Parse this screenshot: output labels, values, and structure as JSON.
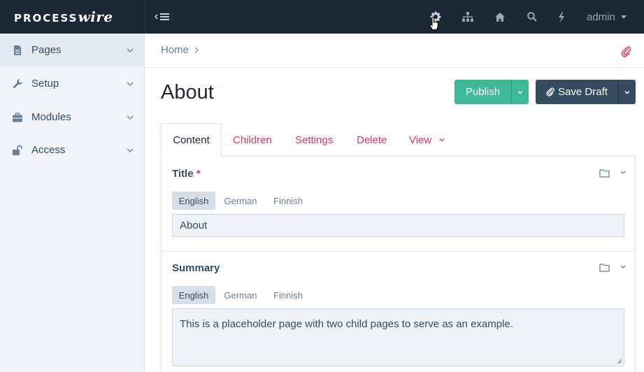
{
  "app": {
    "logo_main": "PROCESS",
    "logo_accent": "wire"
  },
  "topbar": {
    "icons": [
      "gear-icon",
      "sitemap-icon",
      "home-icon",
      "search-icon",
      "bolt-icon"
    ],
    "user_label": "admin"
  },
  "sidebar": {
    "items": [
      {
        "label": "Pages",
        "icon": "file-icon",
        "active": true
      },
      {
        "label": "Setup",
        "icon": "wrench-icon",
        "active": false
      },
      {
        "label": "Modules",
        "icon": "briefcase-icon",
        "active": false
      },
      {
        "label": "Access",
        "icon": "unlock-icon",
        "active": false
      }
    ]
  },
  "breadcrumb": {
    "items": [
      "Home"
    ]
  },
  "page": {
    "title": "About"
  },
  "actions": {
    "publish_label": "Publish",
    "save_draft_label": "Save Draft"
  },
  "tabs": [
    {
      "label": "Content",
      "active": true
    },
    {
      "label": "Children",
      "active": false
    },
    {
      "label": "Settings",
      "active": false
    },
    {
      "label": "Delete",
      "active": false
    },
    {
      "label": "View",
      "active": false
    }
  ],
  "fields": {
    "title": {
      "label": "Title",
      "required_mark": "*",
      "languages": [
        "English",
        "German",
        "Finnish"
      ],
      "active_language": "English",
      "value": "About"
    },
    "summary": {
      "label": "Summary",
      "languages": [
        "English",
        "German",
        "Finnish"
      ],
      "active_language": "English",
      "value": "This is a placeholder page with two child pages to serve as an example."
    }
  },
  "colors": {
    "topbar_bg": "#1c2836",
    "accent_pink": "#e83561",
    "publish_green": "#3eb998",
    "draft_navy": "#354b60",
    "sidebar_bg": "#f0f3f7"
  }
}
